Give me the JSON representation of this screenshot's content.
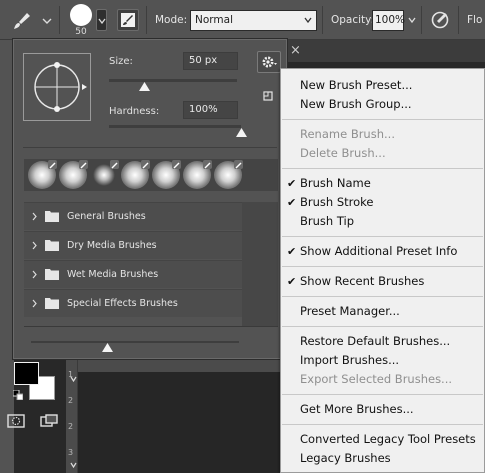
{
  "options_bar": {
    "brush_size": "50",
    "mode_label": "Mode:",
    "mode_value": "Normal",
    "opacity_label": "Opacity:",
    "opacity_value": "100%",
    "flow_label": "Flo"
  },
  "doc_tab": {
    "close": "×"
  },
  "brush_panel": {
    "size_label": "Size:",
    "size_value": "50 px",
    "hardness_label": "Hardness:",
    "hardness_value": "100%",
    "size_slider_level": 0.28,
    "hardness_slider_level": 1.0,
    "preview_slider_level": 0.37,
    "recent_brushes": [
      {
        "icon": "brush-stroke-icon"
      },
      {
        "icon": "brush-stroke-icon"
      },
      {
        "icon": "airbrush-icon"
      },
      {
        "icon": "brush-stroke-icon"
      },
      {
        "icon": "smudge-icon"
      },
      {
        "icon": "brush-tip-icon"
      },
      {
        "icon": "eraser-icon"
      }
    ],
    "folders": [
      {
        "label": "General Brushes"
      },
      {
        "label": "Dry Media Brushes"
      },
      {
        "label": "Wet Media Brushes"
      },
      {
        "label": "Special Effects Brushes"
      }
    ]
  },
  "ruler": {
    "numbers": [
      "1",
      "2",
      "2",
      "3",
      "4",
      "5"
    ]
  },
  "menu": {
    "new_preset": "New Brush Preset...",
    "new_group": "New Brush Group...",
    "rename": "Rename Brush...",
    "delete": "Delete Brush...",
    "brush_name": "Brush Name",
    "brush_stroke": "Brush Stroke",
    "brush_tip": "Brush Tip",
    "show_additional": "Show Additional Preset Info",
    "show_recent": "Show Recent Brushes",
    "preset_manager": "Preset Manager...",
    "restore_default": "Restore Default Brushes...",
    "import": "Import Brushes...",
    "export": "Export Selected Brushes...",
    "get_more": "Get More Brushes...",
    "converted_legacy": "Converted Legacy Tool Presets",
    "legacy": "Legacy Brushes",
    "checkmark": "✔"
  },
  "colors": {
    "panel_bg": "#535353",
    "menu_bg": "#f0f0f0",
    "foreground": "#000000",
    "background": "#ffffff"
  }
}
